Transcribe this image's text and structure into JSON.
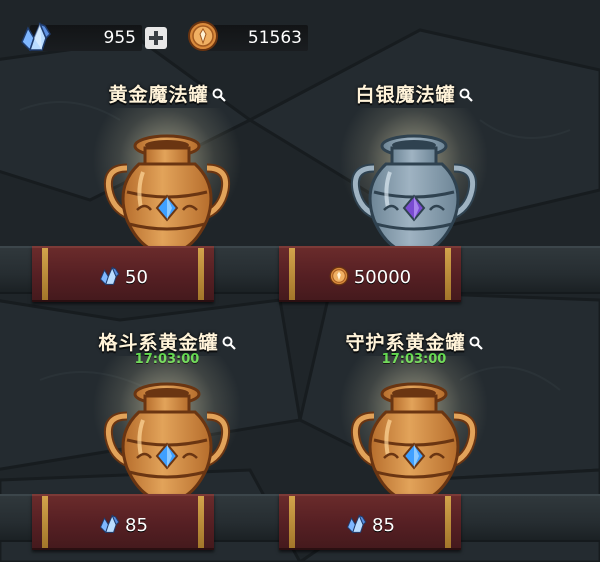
{
  "currency": {
    "gems": "955",
    "coins": "51563"
  },
  "shop": {
    "jars": [
      {
        "title": "黄金魔法罐",
        "timer": "",
        "price": "50",
        "currency_icon": "gem-icon",
        "jar_style": "gold",
        "gem_color": "blue"
      },
      {
        "title": "白银魔法罐",
        "timer": "",
        "price": "50000",
        "currency_icon": "coin-icon",
        "jar_style": "silver",
        "gem_color": "purple"
      },
      {
        "title": "格斗系黄金罐",
        "timer": "17:03:00",
        "price": "85",
        "currency_icon": "gem-icon",
        "jar_style": "gold",
        "gem_color": "blue"
      },
      {
        "title": "守护系黄金罐",
        "timer": "17:03:00",
        "price": "85",
        "currency_icon": "gem-icon",
        "jar_style": "gold",
        "gem_color": "blue"
      }
    ]
  },
  "colors": {
    "title_text": "#fff3d9",
    "timer_text": "#62d84f",
    "price_panel": "#551f23",
    "panel_stripe": "#d2a34b",
    "background": "#1e2428"
  }
}
